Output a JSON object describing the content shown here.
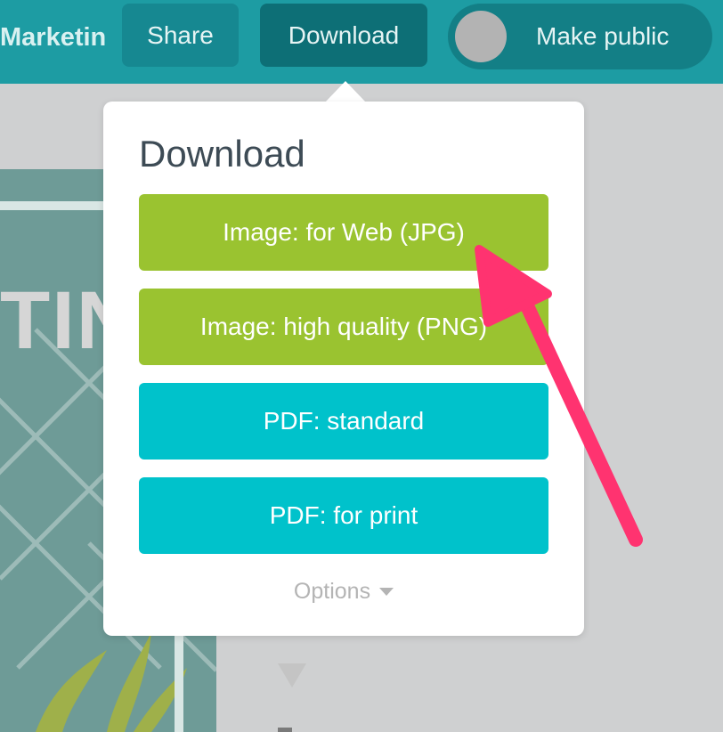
{
  "header": {
    "doc_title": "Marketing is Life",
    "share_label": "Share",
    "download_label": "Download",
    "make_public_label": "Make public"
  },
  "design_preview": {
    "word": "TING"
  },
  "download_menu": {
    "title": "Download",
    "options": [
      {
        "label": "Image: for Web (JPG)"
      },
      {
        "label": "Image: high quality (PNG)"
      },
      {
        "label": "PDF: standard"
      },
      {
        "label": "PDF: for print"
      }
    ],
    "more_label": "Options"
  },
  "colors": {
    "header_teal": "#1d9ca3",
    "image_option_green": "#9ac330",
    "pdf_option_cyan": "#00c2cb",
    "annotation_arrow": "#ff3370"
  },
  "icons": {
    "options_toggle": "caret-down-icon",
    "annotation": "arrow-pointer-icon"
  }
}
